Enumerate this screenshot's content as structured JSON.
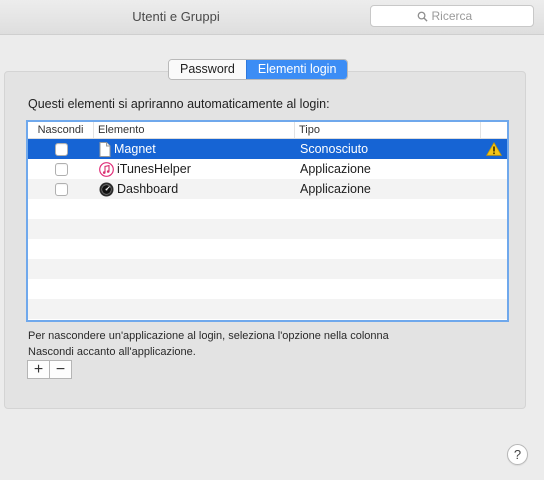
{
  "window": {
    "title": "Utenti e Gruppi"
  },
  "search": {
    "placeholder": "Ricerca",
    "icon": "search-icon"
  },
  "tabs": [
    {
      "label": "Password",
      "active": false
    },
    {
      "label": "Elementi login",
      "active": true
    }
  ],
  "intro": "Questi elementi si apriranno automaticamente al login:",
  "table": {
    "columns": [
      "Nascondi",
      "Elemento",
      "Tipo"
    ],
    "rows": [
      {
        "hidden": false,
        "icon": "document-icon",
        "name": "Magnet",
        "type": "Sconosciuto",
        "warning": true,
        "selected": true
      },
      {
        "hidden": false,
        "icon": "itunes-icon",
        "name": "iTunesHelper",
        "type": "Applicazione",
        "warning": false,
        "selected": false
      },
      {
        "hidden": false,
        "icon": "dashboard-icon",
        "name": "Dashboard",
        "type": "Applicazione",
        "warning": false,
        "selected": false
      }
    ]
  },
  "help_text": {
    "line1": "Per nascondere un'applicazione al login, seleziona l'opzione nella colonna",
    "line2": "Nascondi accanto all'applicazione."
  },
  "buttons": {
    "add": "+",
    "remove": "−",
    "help": "?"
  },
  "colors": {
    "accent": "#3c8df5",
    "selection": "#1664d4",
    "focus_ring": "#6fa8ec"
  }
}
